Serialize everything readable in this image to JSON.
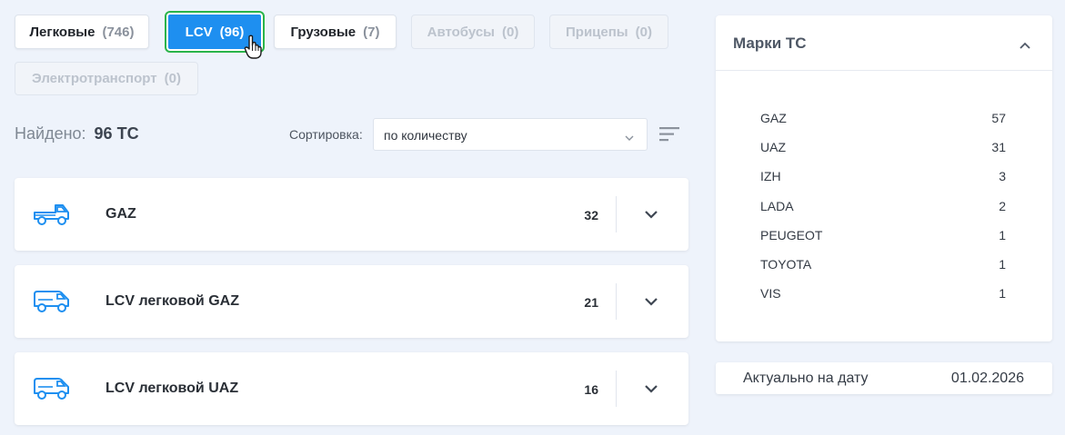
{
  "vehicle_tabs": [
    {
      "label": "Легковые",
      "count": "(746)",
      "state": "normal"
    },
    {
      "label": "LCV",
      "count": "(96)",
      "state": "active"
    },
    {
      "label": "Грузовые",
      "count": "(7)",
      "state": "normal"
    },
    {
      "label": "Автобусы",
      "count": "(0)",
      "state": "disabled"
    },
    {
      "label": "Прицепы",
      "count": "(0)",
      "state": "disabled"
    },
    {
      "label": "Электротранспорт",
      "count": "(0)",
      "state": "disabled"
    }
  ],
  "results": {
    "found_label": "Найдено:",
    "found_value": "96 ТС"
  },
  "sort": {
    "label": "Сортировка:",
    "selected": "по количеству",
    "chevron_icon": "chevron-down-icon",
    "order_icon": "sort-order-icon"
  },
  "groups": [
    {
      "name": "GAZ",
      "count": "32",
      "icon": "pickup-truck-icon"
    },
    {
      "name": "LCV легковой GAZ",
      "count": "21",
      "icon": "van-icon"
    },
    {
      "name": "LCV легковой UAZ",
      "count": "16",
      "icon": "van-icon"
    }
  ],
  "brands_panel": {
    "title": "Марки ТС",
    "collapse_icon": "chevron-up-icon",
    "items": [
      {
        "name": "GAZ",
        "count": "57"
      },
      {
        "name": "UAZ",
        "count": "31"
      },
      {
        "name": "IZH",
        "count": "3"
      },
      {
        "name": "LADA",
        "count": "2"
      },
      {
        "name": "PEUGEOT",
        "count": "1"
      },
      {
        "name": "TOYOTA",
        "count": "1"
      },
      {
        "name": "VIS",
        "count": "1"
      }
    ]
  },
  "actual_date": {
    "label": "Актуально на дату",
    "value": "01.02.2026"
  },
  "colors": {
    "accent": "#1e8ff0",
    "focus_ring": "#2ab44a",
    "background": "#eef3fb",
    "icon": "#1e8ff0"
  }
}
